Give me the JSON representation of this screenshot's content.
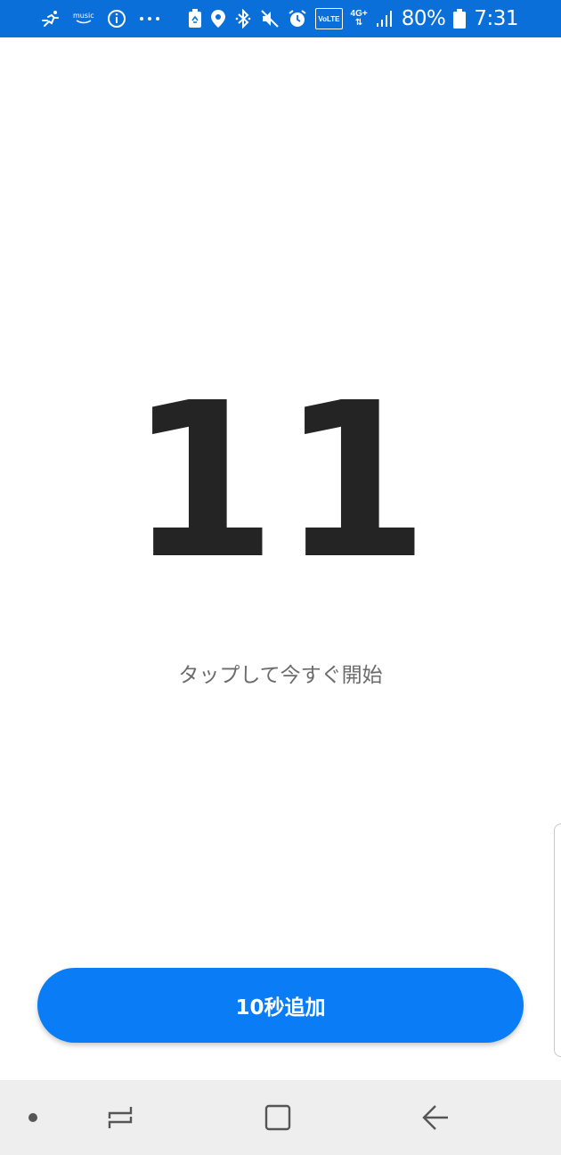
{
  "status_bar": {
    "time": "7:31",
    "battery": "80%",
    "music_label": "music",
    "network": "4G+",
    "volte": "VoLTE",
    "background_color": "#0a6fd9",
    "icons_left": [
      "running-icon",
      "amazon-music-icon",
      "info-icon",
      "more-dots-icon"
    ],
    "icons_right": [
      "battery-saver-icon",
      "location-icon",
      "bluetooth-icon",
      "mute-icon",
      "alarm-icon",
      "volte-icon",
      "network-4g-icon",
      "signal-icon",
      "battery-icon"
    ]
  },
  "timer": {
    "countdown": "11",
    "hint": "タップして今すぐ開始"
  },
  "actions": {
    "add_time_label": "10秒追加",
    "accent_color": "#0a7cf5"
  },
  "nav_bar": {
    "icons": [
      "dot-icon",
      "recent-apps-icon",
      "home-icon",
      "back-icon"
    ]
  }
}
